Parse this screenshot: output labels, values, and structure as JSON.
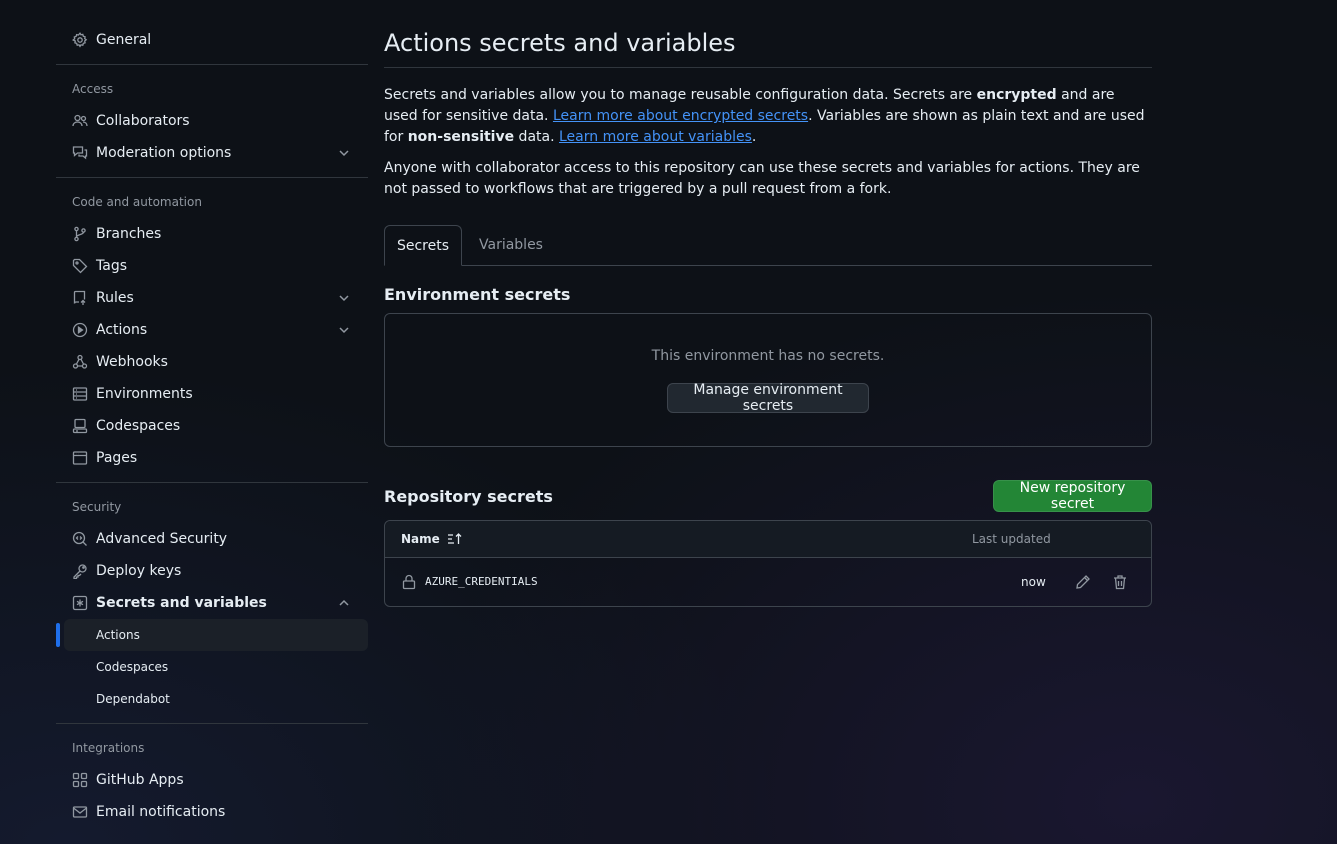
{
  "sidebar": {
    "general": "General",
    "groups": {
      "access": "Access",
      "code": "Code and automation",
      "security": "Security",
      "integrations": "Integrations"
    },
    "items": {
      "collaborators": "Collaborators",
      "moderation": "Moderation options",
      "branches": "Branches",
      "tags": "Tags",
      "rules": "Rules",
      "actions": "Actions",
      "webhooks": "Webhooks",
      "environments": "Environments",
      "codespaces": "Codespaces",
      "pages": "Pages",
      "advanced_security": "Advanced Security",
      "deploy_keys": "Deploy keys",
      "secrets": "Secrets and variables",
      "github_apps": "GitHub Apps",
      "email": "Email notifications"
    },
    "sub_items": {
      "actions": "Actions",
      "codespaces": "Codespaces",
      "dependabot": "Dependabot"
    }
  },
  "main": {
    "title": "Actions secrets and variables",
    "desc1": {
      "t1": "Secrets and variables allow you to manage reusable configuration data. Secrets are ",
      "b1": "encrypted",
      "t2": " and are used for sensitive data. ",
      "link1": "Learn more about encrypted secrets",
      "t3": ". Variables are shown as plain text and are used for ",
      "b2": "non-sensitive",
      "t4": " data. ",
      "link2": "Learn more about variables",
      "t5": "."
    },
    "desc2": "Anyone with collaborator access to this repository can use these secrets and variables for actions. They are not passed to workflows that are triggered by a pull request from a fork.",
    "tabs": [
      "Secrets",
      "Variables"
    ],
    "env_heading": "Environment secrets",
    "env_empty": "This environment has no secrets.",
    "env_button": "Manage environment secrets",
    "repo_heading": "Repository secrets",
    "repo_button": "New repository secret",
    "table": {
      "col_name": "Name",
      "col_updated": "Last updated",
      "rows": [
        {
          "name": "AZURE_CREDENTIALS",
          "updated": "now"
        }
      ]
    }
  },
  "colors": {
    "background": "#0d1117",
    "accent_link": "#4493f8",
    "primary_button": "#238636",
    "active_indicator": "#1f6feb"
  }
}
